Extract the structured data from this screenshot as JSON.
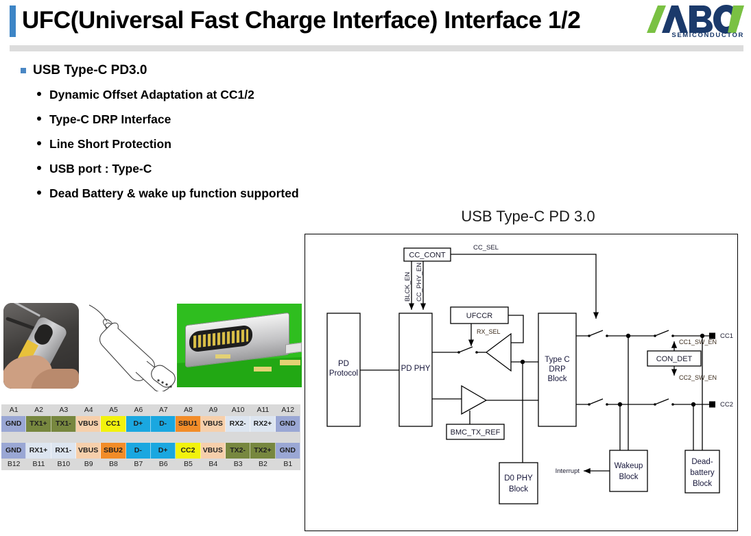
{
  "header": {
    "title": "UFC(Universal Fast Charge Interface) Interface 1/2",
    "logo_word": "ABOV",
    "logo_sub": "SEMICONDUCTOR",
    "accent_color": "#3d85c6",
    "logo_green": "#7ac143",
    "logo_navy": "#1b3a6b"
  },
  "bullets": {
    "main": "USB Type-C PD3.0",
    "sub": [
      "Dynamic Offset Adaptation at CC1/2",
      "Type-C DRP Interface",
      "Line Short Protection",
      "USB port : Type-C",
      "Dead Battery  & wake up function supported"
    ]
  },
  "pin_table": {
    "top_labels": [
      "A1",
      "A2",
      "A3",
      "A4",
      "A5",
      "A6",
      "A7",
      "A8",
      "A9",
      "A10",
      "A11",
      "A12"
    ],
    "top_cells": [
      {
        "label": "GND",
        "color": "#9aa7d4"
      },
      {
        "label": "TX1+",
        "color": "#77873f"
      },
      {
        "label": "TX1-",
        "color": "#77873f"
      },
      {
        "label": "VBUS",
        "color": "#f6cfab"
      },
      {
        "label": "CC1",
        "color": "#f2f20d"
      },
      {
        "label": "D+",
        "color": "#1aa7e0"
      },
      {
        "label": "D-",
        "color": "#1aa7e0"
      },
      {
        "label": "SBU1",
        "color": "#f28c28"
      },
      {
        "label": "VBUS",
        "color": "#f6cfab"
      },
      {
        "label": "RX2-",
        "color": "#dde5f0"
      },
      {
        "label": "RX2+",
        "color": "#dde5f0"
      },
      {
        "label": "GND",
        "color": "#9aa7d4"
      }
    ],
    "bottom_cells": [
      {
        "label": "GND",
        "color": "#9aa7d4"
      },
      {
        "label": "RX1+",
        "color": "#dde5f0"
      },
      {
        "label": "RX1-",
        "color": "#dde5f0"
      },
      {
        "label": "VBUS",
        "color": "#f6cfab"
      },
      {
        "label": "SBU2",
        "color": "#f28c28"
      },
      {
        "label": "D-",
        "color": "#1aa7e0"
      },
      {
        "label": "D+",
        "color": "#1aa7e0"
      },
      {
        "label": "CC2",
        "color": "#f2f20d"
      },
      {
        "label": "VBUS",
        "color": "#f6cfab"
      },
      {
        "label": "TX2-",
        "color": "#77873f"
      },
      {
        "label": "TX2+",
        "color": "#77873f"
      },
      {
        "label": "GND",
        "color": "#9aa7d4"
      }
    ],
    "bottom_labels": [
      "B12",
      "B11",
      "B10",
      "B9",
      "B8",
      "B7",
      "B6",
      "B5",
      "B4",
      "B3",
      "B2",
      "B1"
    ]
  },
  "diagram": {
    "title": "USB Type-C PD 3.0",
    "blocks": {
      "pd_protocol_l1": "PD",
      "pd_protocol_l2": "Protocol",
      "pd_phy": "PD PHY",
      "cc_cont": "CC_CONT",
      "ufccr": "UFCCR",
      "bmc_tx_ref": "BMC_TX_REF",
      "typec_l1": "Type C",
      "typec_l2": "DRP",
      "typec_l3": "Block",
      "d0phy_l1": "D0 PHY",
      "d0phy_l2": "Block",
      "wakeup_l1": "Wakeup",
      "wakeup_l2": "Block",
      "deadbatt_l1": "Dead-",
      "deadbatt_l2": "battery",
      "deadbatt_l3": "Block",
      "con_det": "CON_DET"
    },
    "signals": {
      "cc_sel": "CC_SEL",
      "blck_en": "BLCK_EN",
      "cc_phy_en": "CC_PHY_EN",
      "rx_sel": "RX_SEL",
      "cc1_sw_en": "CC1_SW_EN",
      "cc2_sw_en": "CC2_SW_EN",
      "interrupt": "Interrupt"
    },
    "pins": {
      "cc1": "CC1",
      "cc2": "CC2"
    }
  }
}
